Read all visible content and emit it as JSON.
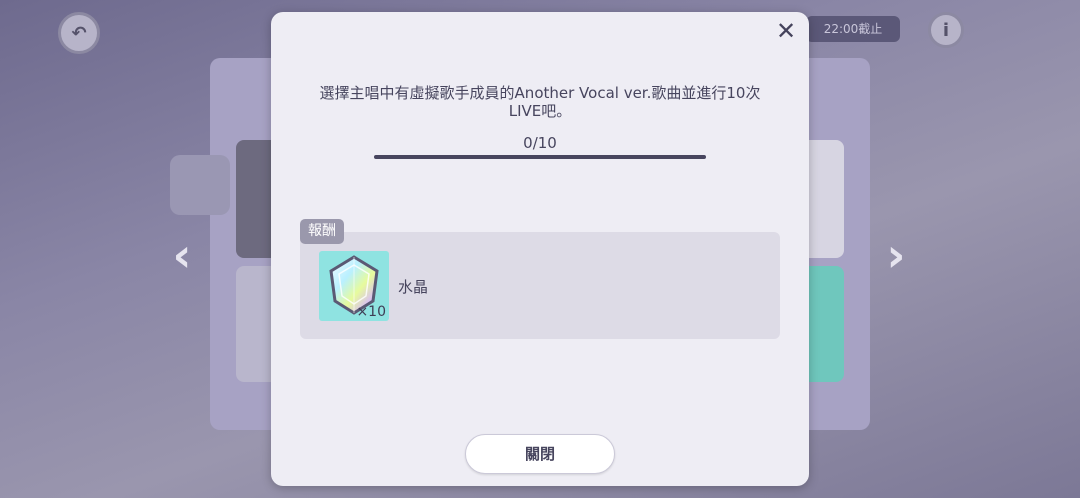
{
  "background": {
    "top_pill_text": "22:00截止"
  },
  "dialog": {
    "close_icon": "close-icon",
    "mission_text": "選擇主唱中有虛擬歌手成員的Another Vocal ver.歌曲並進行10次LIVE吧。",
    "progress": {
      "current": 0,
      "total": 10,
      "label": "0/10"
    },
    "reward": {
      "tag": "報酬",
      "item": {
        "icon": "crystal-icon",
        "quantity": "×10",
        "name": "水晶"
      }
    },
    "close_button_label": "關閉"
  },
  "colors": {
    "modal_bg": "#eeedf4",
    "text": "#47455e",
    "progress_track": "#47455e",
    "reward_tile": "#8fe3e1",
    "reward_box": "#dddbe6",
    "tag_bg": "#9a98ac"
  }
}
